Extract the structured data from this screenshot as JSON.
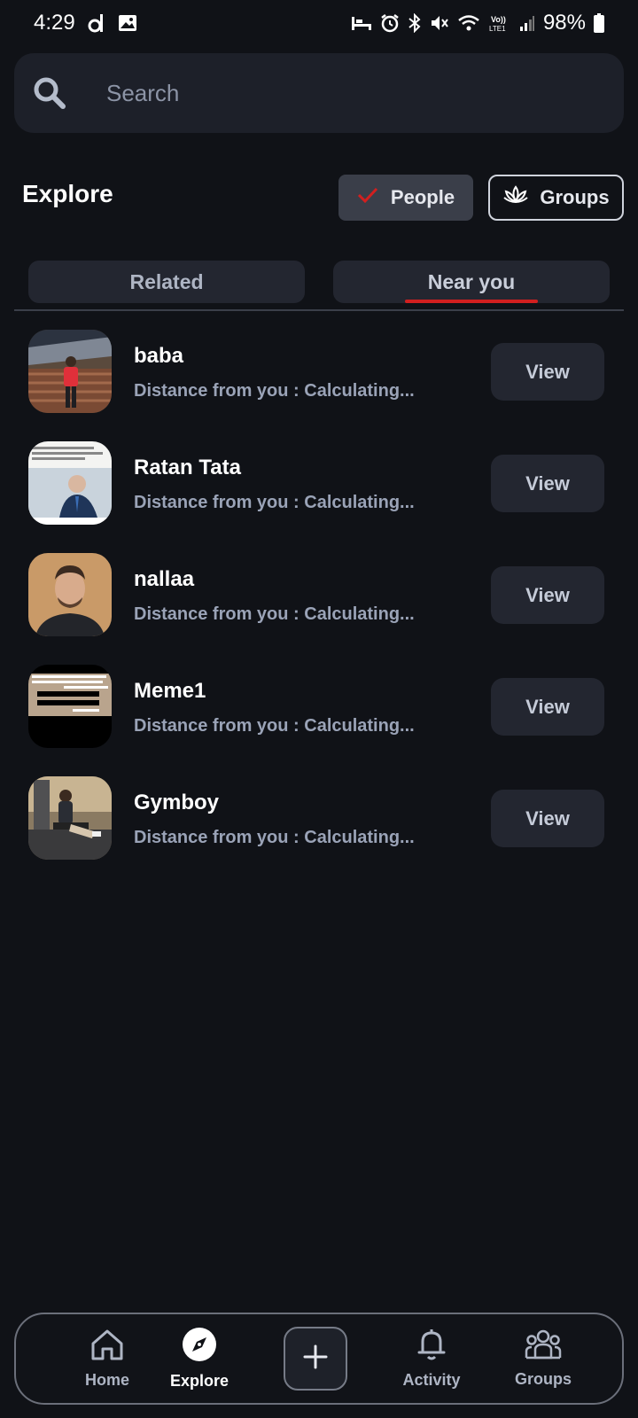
{
  "status": {
    "time": "4:29",
    "battery": "98%"
  },
  "search": {
    "placeholder": "Search"
  },
  "header": {
    "title": "Explore",
    "people_label": "People",
    "groups_label": "Groups"
  },
  "tabs": [
    {
      "label": "Related"
    },
    {
      "label": "Near you"
    }
  ],
  "users": [
    {
      "name": "baba",
      "distance": "Distance from you : Calculating...",
      "action": "View"
    },
    {
      "name": "Ratan Tata",
      "distance": "Distance from you : Calculating...",
      "action": "View"
    },
    {
      "name": "nallaa",
      "distance": "Distance from you : Calculating...",
      "action": "View"
    },
    {
      "name": "Meme1",
      "distance": "Distance from you : Calculating...",
      "action": "View"
    },
    {
      "name": "Gymboy",
      "distance": "Distance from you : Calculating...",
      "action": "View"
    }
  ],
  "nav": {
    "home": "Home",
    "explore": "Explore",
    "activity": "Activity",
    "groups": "Groups"
  },
  "colors": {
    "background": "#101217",
    "accent_red": "#d21f1f",
    "surface": "#232630"
  }
}
